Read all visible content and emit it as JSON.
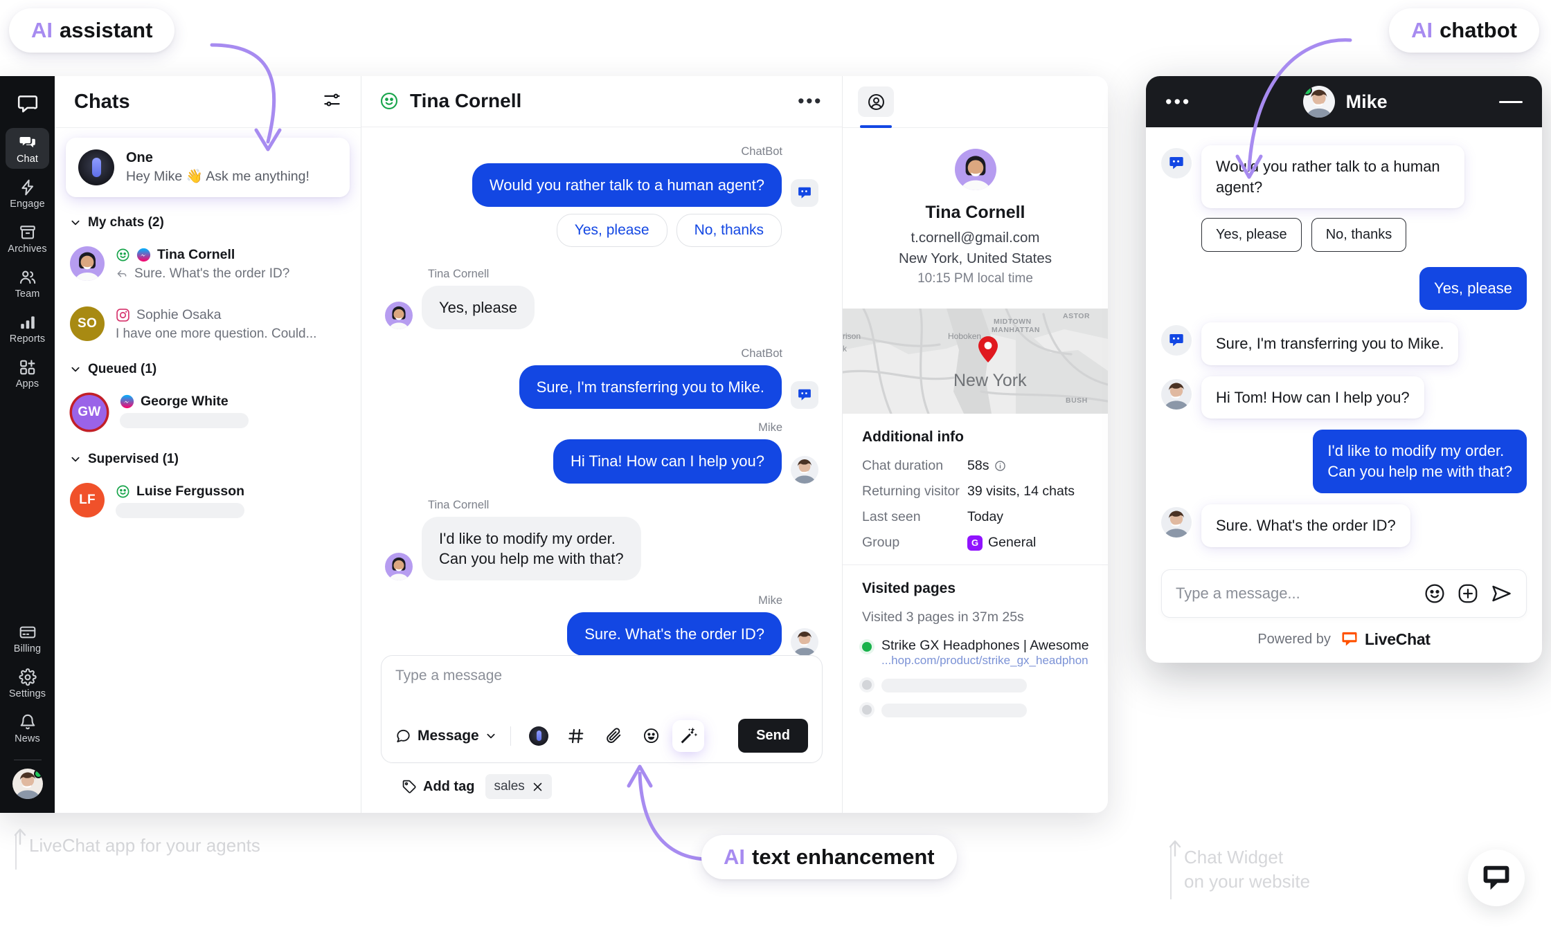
{
  "callouts": {
    "ai_assistant": {
      "ai": "AI",
      "rest": "assistant"
    },
    "ai_chatbot": {
      "ai": "AI",
      "rest": "chatbot"
    },
    "ai_text_enhancement": {
      "ai": "AI",
      "rest": "text enhancement"
    }
  },
  "footnotes": {
    "app": "LiveChat app for your agents",
    "widget_line1": "Chat Widget",
    "widget_line2": "on your website"
  },
  "rail": {
    "items": [
      {
        "label": "Chat",
        "icon": "chats-icon",
        "active": true
      },
      {
        "label": "Engage",
        "icon": "bolt-icon",
        "active": false
      },
      {
        "label": "Archives",
        "icon": "archive-icon",
        "active": false
      },
      {
        "label": "Team",
        "icon": "team-icon",
        "active": false
      },
      {
        "label": "Reports",
        "icon": "bar-chart-icon",
        "active": false
      },
      {
        "label": "Apps",
        "icon": "apps-grid-icon",
        "active": false
      }
    ],
    "bottom": [
      {
        "label": "Billing",
        "icon": "card-icon"
      },
      {
        "label": "Settings",
        "icon": "gear-icon"
      },
      {
        "label": "News",
        "icon": "bell-icon"
      }
    ]
  },
  "chats": {
    "title": "Chats",
    "filter_icon": "filters-icon",
    "assistant": {
      "name": "One",
      "message": "Hey Mike 👋 Ask me anything!"
    },
    "groups": [
      {
        "label": "My chats (2)",
        "items": [
          {
            "name": "Tina Cornell",
            "snippet": "Sure. What's the order ID?",
            "bold": true,
            "avatar": "photo",
            "avatar_color": "#b69cf0",
            "initials": "",
            "badges": [
              "smiley-green-icon",
              "messenger-icon"
            ],
            "reply_icon": true,
            "ring": false,
            "skeleton": false
          },
          {
            "name": "Sophie Osaka",
            "snippet": "I have one more question. Could...",
            "bold": false,
            "avatar": "initials",
            "avatar_color": "#a88a12",
            "initials": "SO",
            "badges": [
              "instagram-icon"
            ],
            "reply_icon": false,
            "ring": false,
            "skeleton": false
          }
        ]
      },
      {
        "label": "Queued (1)",
        "items": [
          {
            "name": "George White",
            "snippet": "",
            "bold": true,
            "avatar": "initials",
            "avatar_color": "#9a63e8",
            "initials": "GW",
            "badges": [
              "messenger-icon"
            ],
            "reply_icon": false,
            "ring": true,
            "skeleton": true
          }
        ]
      },
      {
        "label": "Supervised (1)",
        "items": [
          {
            "name": "Luise  Fergusson",
            "snippet": "",
            "bold": true,
            "avatar": "initials",
            "avatar_color": "#f0512a",
            "initials": "LF",
            "badges": [
              "smiley-green-icon"
            ],
            "reply_icon": false,
            "ring": false,
            "skeleton": true
          }
        ]
      }
    ]
  },
  "conversation": {
    "header": {
      "name": "Tina Cornell",
      "status_icon": "smiley-green-icon",
      "menu_icon": "more-horizontal-icon"
    },
    "messages": [
      {
        "author": "ChatBot",
        "side": "right",
        "text": "Would you rather talk to a human agent?",
        "avatar": "bot"
      },
      {
        "author": "",
        "side": "right",
        "type": "quick_replies",
        "options": [
          "Yes, please",
          "No, thanks"
        ]
      },
      {
        "author": "Tina Cornell",
        "side": "left",
        "text": "Yes, please",
        "avatar": "tina"
      },
      {
        "author": "ChatBot",
        "side": "right",
        "text": "Sure, I'm transferring you to Mike.",
        "avatar": "bot"
      },
      {
        "author": "Mike",
        "side": "right",
        "text": "Hi Tina! How can I help you?",
        "avatar": "mike"
      },
      {
        "author": "Tina Cornell",
        "side": "left",
        "text": "I'd like to modify my order.\nCan you help me with that?",
        "avatar": "tina"
      },
      {
        "author": "Mike",
        "side": "right",
        "text": "Sure. What's the order ID?",
        "avatar": "mike"
      }
    ],
    "composer": {
      "placeholder": "Type a message",
      "mode_label": "Message",
      "mode_caret_icon": "chevron-down-icon",
      "icons": [
        "one-ai-icon",
        "hash-icon",
        "attachment-icon",
        "emoji-icon",
        "magic-wand-icon"
      ],
      "send_label": "Send"
    },
    "tags": {
      "add_label": "Add tag",
      "add_icon": "tag-icon",
      "chips": [
        {
          "label": "sales",
          "remove_icon": "close-icon"
        }
      ]
    }
  },
  "details": {
    "tab_icon": "user-circle-icon",
    "profile": {
      "name": "Tina Cornell",
      "email": "t.cornell@gmail.com",
      "location": "New York, United States",
      "local_time": "10:15 PM local time"
    },
    "map": {
      "labels": [
        "MIDTOWN",
        "MANHATTAN",
        "Hoboken",
        "ASTOR",
        "rison",
        "New York",
        "BUSH",
        "k"
      ],
      "pin_color": "#e0191f"
    },
    "additional_info": {
      "title": "Additional info",
      "rows": [
        {
          "key": "Chat duration",
          "value": "58s",
          "info_icon": true
        },
        {
          "key": "Returning visitor",
          "value": "39 visits, 14 chats",
          "info_icon": false
        },
        {
          "key": "Last seen",
          "value": "Today",
          "info_icon": false
        },
        {
          "key": "Group",
          "value": "General",
          "badge": "G",
          "info_icon": false
        }
      ]
    },
    "visited_pages": {
      "title": "Visited pages",
      "summary": "Visited 3 pages in 37m 25s",
      "items": [
        {
          "title": "Strike GX Headphones | Awesome",
          "url": "...hop.com/product/strike_gx_headphon",
          "active": true
        },
        {
          "title": "",
          "url": "",
          "active": false
        },
        {
          "title": "",
          "url": "",
          "active": false
        }
      ]
    }
  },
  "widget": {
    "header": {
      "menu_icon": "more-horizontal-icon",
      "agent_name": "Mike",
      "minimize_icon": "minimize-icon",
      "online": true
    },
    "messages": [
      {
        "side": "left",
        "avatar": "bot",
        "text": "Would you rather talk to a human agent?"
      },
      {
        "side": "left",
        "type": "quick_replies",
        "options": [
          "Yes, please",
          "No, thanks"
        ]
      },
      {
        "side": "right",
        "text": "Yes, please"
      },
      {
        "side": "left",
        "avatar": "bot",
        "text": "Sure, I'm transferring you to Mike."
      },
      {
        "side": "left",
        "avatar": "mike",
        "text": "Hi Tom! How can I help you?"
      },
      {
        "side": "right",
        "text": "I'd like to modify my order.\nCan you help me with that?"
      },
      {
        "side": "left",
        "avatar": "mike",
        "text": "Sure. What's the order ID?"
      }
    ],
    "input": {
      "placeholder": "Type a message...",
      "icons": [
        "emoji-icon",
        "plus-circle-icon",
        "send-plane-icon"
      ]
    },
    "powered_by": {
      "text": "Powered by",
      "brand": "LiveChat"
    }
  },
  "colors": {
    "brand_blue": "#1347e3",
    "ai_purple": "#a78bf0",
    "livechat_orange": "#ff5100",
    "online_green": "#20c75a",
    "dark": "#0f1114"
  }
}
